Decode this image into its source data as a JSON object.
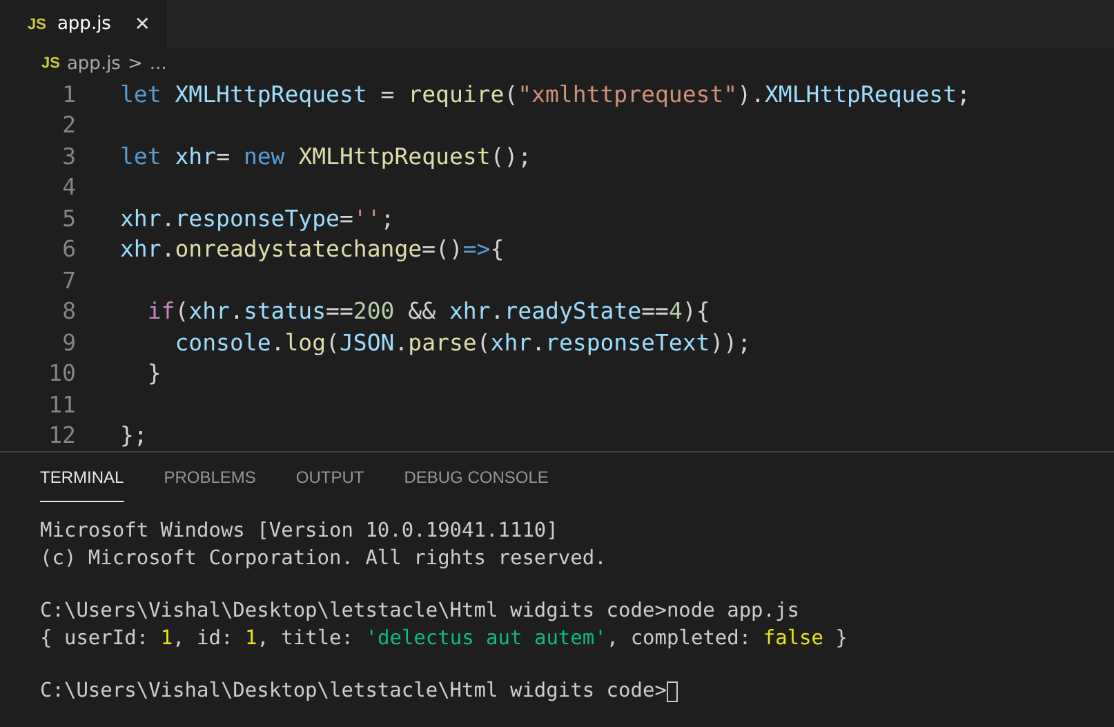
{
  "tabs": [
    {
      "icon_text": "JS",
      "label": "app.js",
      "close": "✕",
      "selected": true
    }
  ],
  "breadcrumb": {
    "icon_text": "JS",
    "file": "app.js",
    "separator": ">",
    "more": "..."
  },
  "editor": {
    "lines": [
      {
        "number": "1",
        "tokens": [
          {
            "kind": "keyword",
            "text": "let "
          },
          {
            "kind": "variable",
            "text": "XMLHttpRequest"
          },
          {
            "kind": "plain",
            "text": " = "
          },
          {
            "kind": "function",
            "text": "require"
          },
          {
            "kind": "plain",
            "text": "("
          },
          {
            "kind": "string",
            "text": "\"xmlhttprequest\""
          },
          {
            "kind": "plain",
            "text": ")."
          },
          {
            "kind": "variable",
            "text": "XMLHttpRequest"
          },
          {
            "kind": "plain",
            "text": ";"
          }
        ]
      },
      {
        "number": "2"
      },
      {
        "number": "3",
        "tokens": [
          {
            "kind": "keyword",
            "text": "let "
          },
          {
            "kind": "variable",
            "text": "xhr"
          },
          {
            "kind": "plain",
            "text": "= "
          },
          {
            "kind": "keyword",
            "text": "new "
          },
          {
            "kind": "function",
            "text": "XMLHttpRequest"
          },
          {
            "kind": "plain",
            "text": "();"
          }
        ]
      },
      {
        "number": "4"
      },
      {
        "number": "5",
        "tokens": [
          {
            "kind": "variable",
            "text": "xhr"
          },
          {
            "kind": "plain",
            "text": "."
          },
          {
            "kind": "variable",
            "text": "responseType"
          },
          {
            "kind": "plain",
            "text": "="
          },
          {
            "kind": "string",
            "text": "''"
          },
          {
            "kind": "plain",
            "text": ";"
          }
        ]
      },
      {
        "number": "6",
        "tokens": [
          {
            "kind": "variable",
            "text": "xhr"
          },
          {
            "kind": "plain",
            "text": "."
          },
          {
            "kind": "function",
            "text": "onreadystatechange"
          },
          {
            "kind": "plain",
            "text": "=()"
          },
          {
            "kind": "keyword",
            "text": "=>"
          },
          {
            "kind": "plain",
            "text": "{"
          }
        ]
      },
      {
        "number": "7"
      },
      {
        "number": "8",
        "tokens": [
          {
            "kind": "control",
            "text": "  if"
          },
          {
            "kind": "plain",
            "text": "("
          },
          {
            "kind": "variable",
            "text": "xhr"
          },
          {
            "kind": "plain",
            "text": "."
          },
          {
            "kind": "variable",
            "text": "status"
          },
          {
            "kind": "plain",
            "text": "=="
          },
          {
            "kind": "number",
            "text": "200"
          },
          {
            "kind": "plain",
            "text": " && "
          },
          {
            "kind": "variable",
            "text": "xhr"
          },
          {
            "kind": "plain",
            "text": "."
          },
          {
            "kind": "variable",
            "text": "readyState"
          },
          {
            "kind": "plain",
            "text": "=="
          },
          {
            "kind": "number",
            "text": "4"
          },
          {
            "kind": "plain",
            "text": "){"
          }
        ]
      },
      {
        "number": "9",
        "tokens": [
          {
            "kind": "variable",
            "text": "    console"
          },
          {
            "kind": "plain",
            "text": "."
          },
          {
            "kind": "function",
            "text": "log"
          },
          {
            "kind": "plain",
            "text": "("
          },
          {
            "kind": "variable",
            "text": "JSON"
          },
          {
            "kind": "plain",
            "text": "."
          },
          {
            "kind": "function",
            "text": "parse"
          },
          {
            "kind": "plain",
            "text": "("
          },
          {
            "kind": "variable",
            "text": "xhr"
          },
          {
            "kind": "plain",
            "text": "."
          },
          {
            "kind": "variable",
            "text": "responseText"
          },
          {
            "kind": "plain",
            "text": "));"
          }
        ]
      },
      {
        "number": "10",
        "tokens": [
          {
            "kind": "plain",
            "text": "  }"
          }
        ]
      },
      {
        "number": "11"
      },
      {
        "number": "12",
        "tokens": [
          {
            "kind": "plain",
            "text": "};"
          }
        ]
      }
    ]
  },
  "panel": {
    "tabs": [
      {
        "label": "TERMINAL",
        "selected": true
      },
      {
        "label": "PROBLEMS",
        "selected": false
      },
      {
        "label": "OUTPUT",
        "selected": false
      },
      {
        "label": "DEBUG CONSOLE",
        "selected": false
      }
    ],
    "terminal_blocks": [
      {
        "lines": [
          {
            "tokens": [
              {
                "kind": "plain",
                "text": "Microsoft Windows [Version 10.0.19041.1110]"
              }
            ]
          },
          {
            "tokens": [
              {
                "kind": "plain",
                "text": "(c) Microsoft Corporation. All rights reserved."
              }
            ]
          }
        ]
      },
      {
        "lines": [
          {
            "tokens": [
              {
                "kind": "plain",
                "text": "C:\\Users\\Vishal\\Desktop\\letstacle\\Html widgits code>node app.js"
              }
            ]
          },
          {
            "tokens": [
              {
                "kind": "plain",
                "text": "{ userId: "
              },
              {
                "kind": "number",
                "text": "1"
              },
              {
                "kind": "plain",
                "text": ", id: "
              },
              {
                "kind": "number",
                "text": "1"
              },
              {
                "kind": "plain",
                "text": ", title: "
              },
              {
                "kind": "string",
                "text": "'delectus aut autem'"
              },
              {
                "kind": "plain",
                "text": ", completed: "
              },
              {
                "kind": "number",
                "text": "false"
              },
              {
                "kind": "plain",
                "text": " }"
              }
            ]
          }
        ]
      },
      {
        "lines": [
          {
            "tokens": [
              {
                "kind": "plain",
                "text": "C:\\Users\\Vishal\\Desktop\\letstacle\\Html widgits code>"
              }
            ],
            "cursor": true
          }
        ]
      }
    ]
  }
}
